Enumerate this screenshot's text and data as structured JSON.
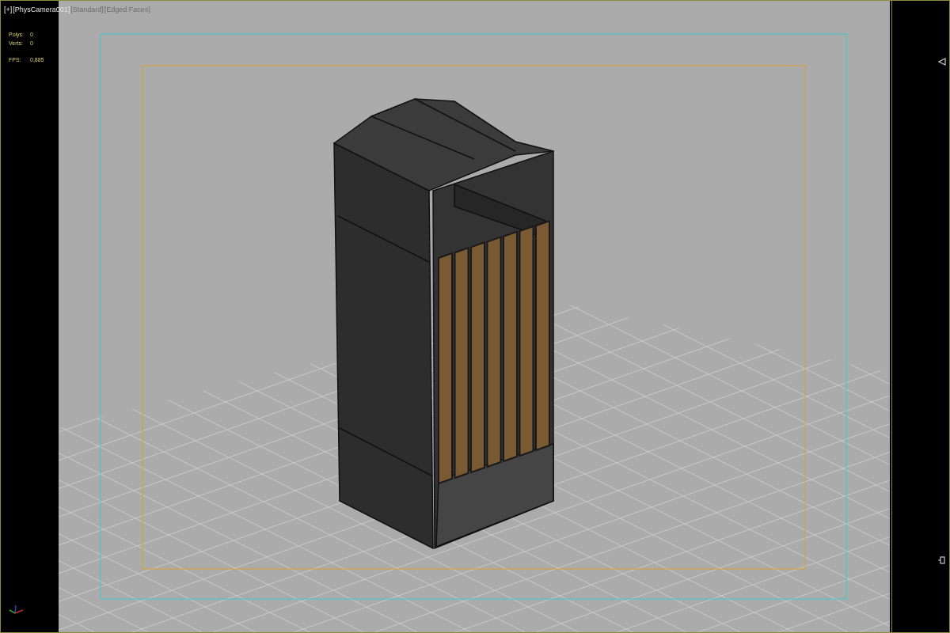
{
  "viewport_labels": [
    {
      "text": "[+]",
      "active": true
    },
    {
      "text": "[PhysCamera001]",
      "active": true
    },
    {
      "text": "[Standard]",
      "active": false
    },
    {
      "text": "[Edged Faces]",
      "active": false
    }
  ],
  "stats": [
    {
      "label": "Polys:",
      "value": "0"
    },
    {
      "label": "Verts:",
      "value": "0"
    },
    {
      "label": "FPS:",
      "value": "0,885"
    }
  ]
}
